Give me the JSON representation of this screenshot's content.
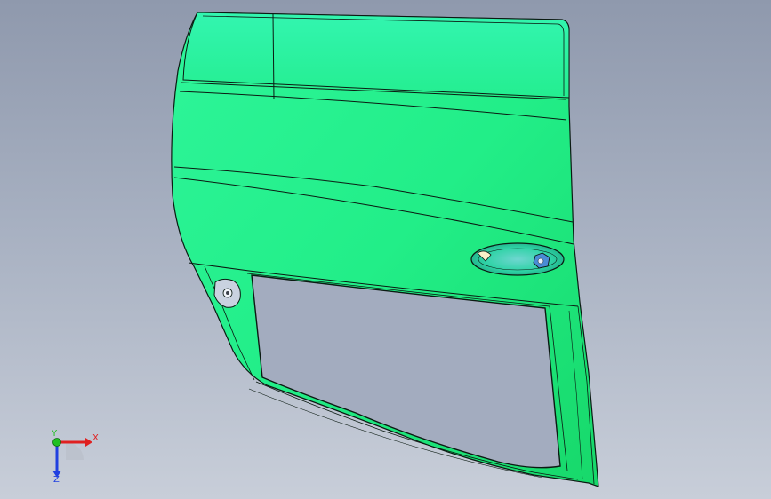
{
  "viewport": {
    "background_top": "#8f99ad",
    "background_bottom": "#c8ced9"
  },
  "model": {
    "part": "car-door-shell",
    "fill_color": "#2ff09a",
    "edge_color": "#0b1a12"
  },
  "triad": {
    "x_label": "X",
    "y_label": "Y",
    "z_label": "Z",
    "x_color": "#e02020",
    "y_color": "#20c020",
    "z_color": "#2040e0"
  }
}
